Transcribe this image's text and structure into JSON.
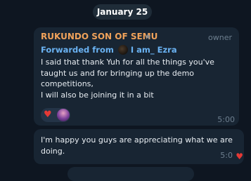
{
  "date_separator": "January 25",
  "messages": [
    {
      "sender": "RUKUNDO SON OF SEMU",
      "sender_badge": "star-icon",
      "role": "owner",
      "forwarded_label": "Forwarded from",
      "forwarded_from": "I am_ Ezra",
      "lines": [
        "I said that thank Yuh for all the things you've",
        "taught us and for bringing up the demo",
        "competitions,",
        "I will also be joining it in a bit"
      ],
      "reaction": "heart",
      "time": "5:00"
    },
    {
      "lines": [
        "I'm happy you guys are appreciating what we are",
        "doing."
      ],
      "time": "5:0",
      "reaction": "heart"
    }
  ],
  "colors": {
    "background": "#0e1621",
    "bubble": "#182533",
    "sender": "#f0a25a",
    "link": "#6ab2f2",
    "reaction": "#e53935"
  }
}
